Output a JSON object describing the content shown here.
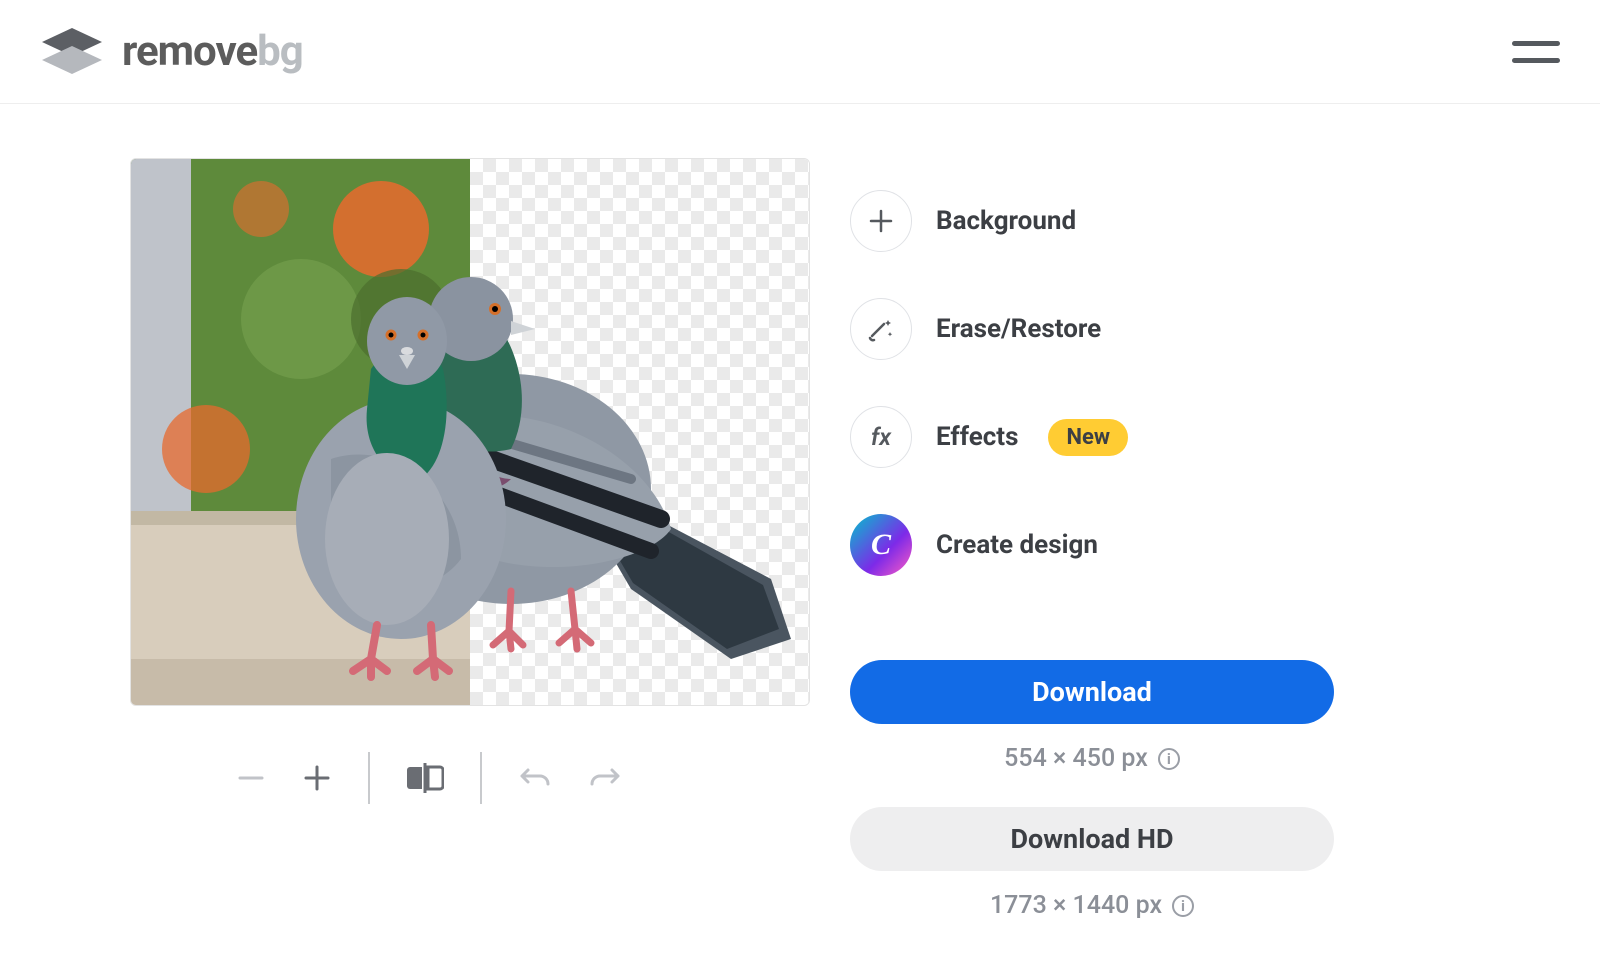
{
  "brand": {
    "name_part1": "remove",
    "name_part2": "bg"
  },
  "tools": {
    "background": {
      "label": "Background"
    },
    "erase_restore": {
      "label": "Erase/Restore"
    },
    "effects": {
      "label": "Effects",
      "badge": "New"
    },
    "create_design": {
      "label": "Create design",
      "icon_letter": "C"
    }
  },
  "download": {
    "primary_label": "Download",
    "primary_dimensions": "554 × 450 px",
    "secondary_label": "Download HD",
    "secondary_dimensions": "1773 × 1440 px"
  }
}
